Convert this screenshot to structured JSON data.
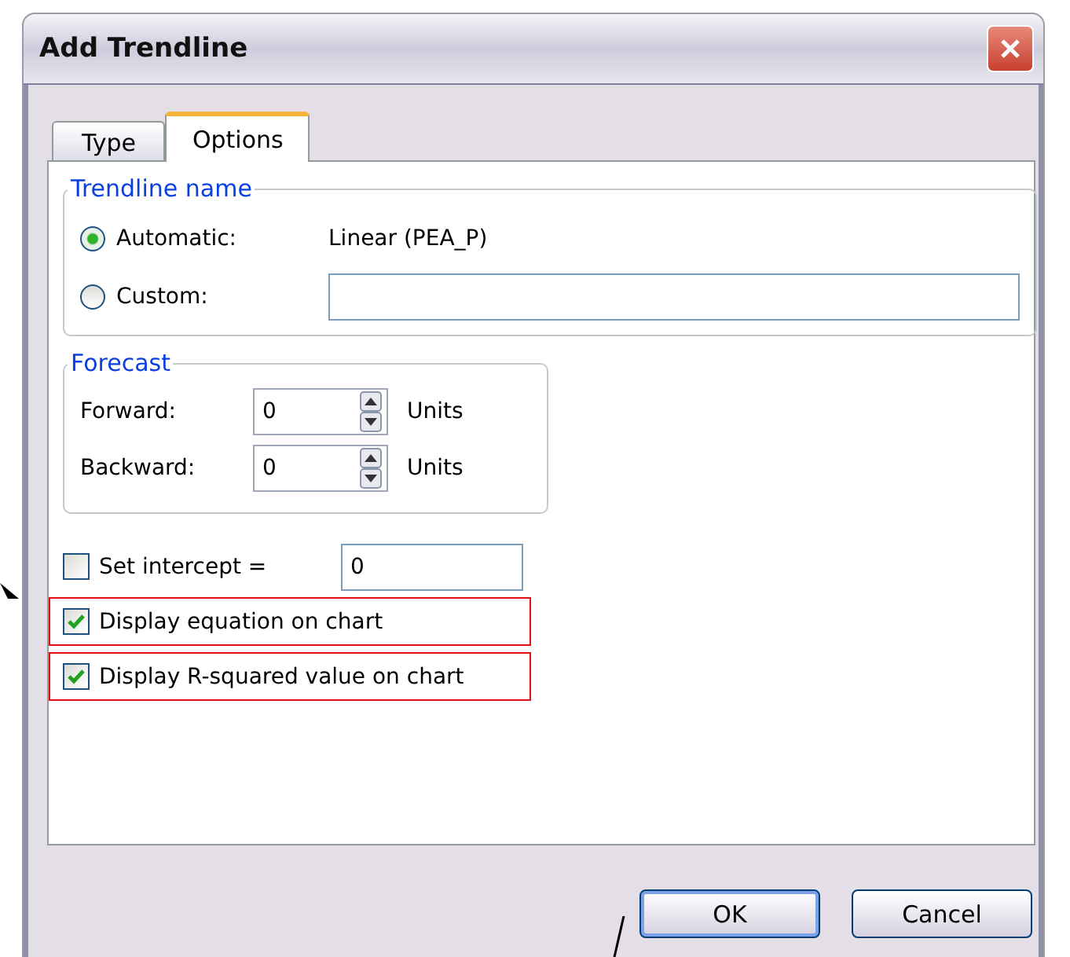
{
  "window": {
    "title": "Add Trendline"
  },
  "tabs": [
    {
      "label": "Type",
      "selected": false
    },
    {
      "label": "Options",
      "selected": true
    }
  ],
  "trendline_name": {
    "title": "Trendline name",
    "options": [
      {
        "label": "Automatic:",
        "selected": true,
        "kind": "text",
        "value": "Linear (PEA_P)"
      },
      {
        "label": "Custom:",
        "selected": false,
        "kind": "field"
      }
    ]
  },
  "forecast": {
    "title": "Forecast",
    "rows": [
      {
        "label": "Forward:",
        "value": "0",
        "unit": "Units"
      },
      {
        "label": "Backward:",
        "value": "0",
        "unit": "Units"
      }
    ]
  },
  "checks": [
    {
      "label": "Set intercept =",
      "checked": false,
      "highlighted": false,
      "value": "0"
    },
    {
      "label": "Display equation on chart",
      "checked": true,
      "highlighted": true
    },
    {
      "label": "Display R-squared value on chart",
      "checked": true,
      "highlighted": true
    }
  ],
  "buttons": [
    "OK",
    "Cancel"
  ]
}
